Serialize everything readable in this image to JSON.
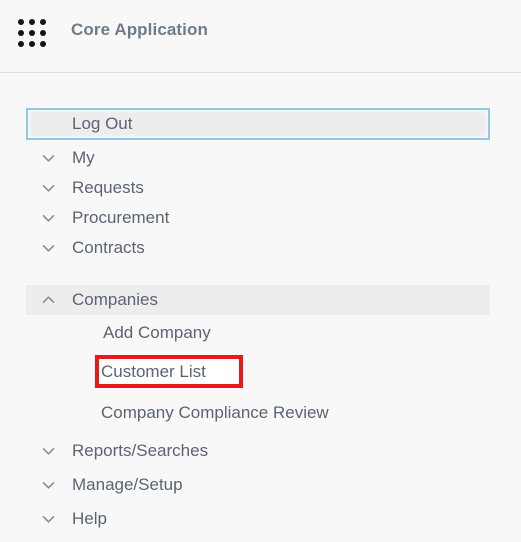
{
  "header": {
    "title": "Core Application",
    "grid_icon": "apps-grid-icon",
    "dot_count": 9
  },
  "colors": {
    "page_background": "#f8f8f8",
    "row_highlight": "#ededed",
    "focus_ring": "#8ecae6",
    "annotation_red": "#e51a1a",
    "text": "#5a6472",
    "title_text": "#6f7b86",
    "divider": "#dcdcdc"
  },
  "nav": {
    "logout": {
      "label": "Log Out",
      "state": "focused"
    },
    "items": [
      {
        "label": "My",
        "icon": "chevron-down-icon",
        "expanded": false
      },
      {
        "label": "Requests",
        "icon": "chevron-down-icon",
        "expanded": false
      },
      {
        "label": "Procurement",
        "icon": "chevron-down-icon",
        "expanded": false
      },
      {
        "label": "Contracts",
        "icon": "chevron-down-icon",
        "expanded": false
      },
      {
        "label": "Companies",
        "icon": "chevron-up-icon",
        "expanded": true
      },
      {
        "label": "Reports/Searches",
        "icon": "chevron-down-icon",
        "expanded": false
      },
      {
        "label": "Manage/Setup",
        "icon": "chevron-down-icon",
        "expanded": false
      },
      {
        "label": "Help",
        "icon": "chevron-down-icon",
        "expanded": false
      }
    ],
    "companies_submenu": [
      {
        "label": "Add Company",
        "highlighted": false
      },
      {
        "label": "Customer List",
        "highlighted": true
      },
      {
        "label": "Company Compliance Review",
        "highlighted": false
      }
    ]
  }
}
